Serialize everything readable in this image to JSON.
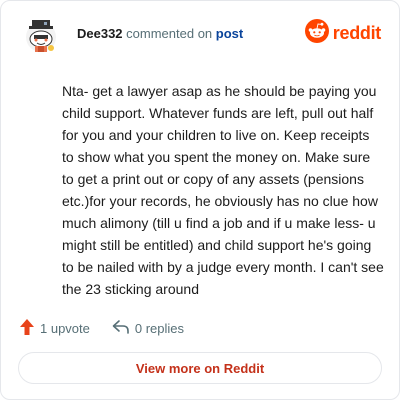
{
  "header": {
    "author": "Dee332",
    "action_text": "commented on",
    "post_link_text": "post",
    "brand_text": "reddit"
  },
  "comment": {
    "text": "Nta- get a lawyer asap as he should be paying you child support. Whatever funds are left, pull out half for you and your children to live on. Keep receipts to show what you spent the money on. Make sure to get a print out or copy of any assets (pensions etc.)for your records, he obviously has no clue how much alimony (till u find a job and if u make less- u might still be entitled) and child support he's going to be nailed with by a judge every month. I can't see the 23 sticking around"
  },
  "footer": {
    "upvotes_label": "1 upvote",
    "replies_label": "0 replies",
    "view_more_label": "View more on Reddit"
  },
  "colors": {
    "brand": "#ff4500",
    "link": "#0a449b",
    "button_text": "#c4311a"
  },
  "icons": {
    "avatar": "snoo-avatar-icon",
    "logo": "reddit-logo-icon",
    "upvote": "upvote-arrow-icon",
    "reply": "reply-arrow-icon"
  }
}
